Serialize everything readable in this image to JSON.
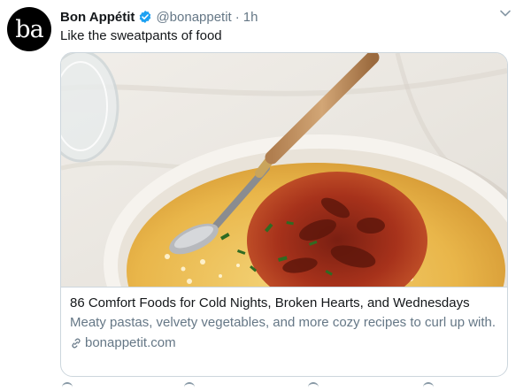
{
  "tweet": {
    "avatar_text": "ba",
    "name": "Bon Appétit",
    "handle": "@bonappetit",
    "separator": "·",
    "time": "1h",
    "text": "Like the sweatpants of food",
    "verified_icon": "verified-badge-icon",
    "menu_icon": "chevron-down-icon"
  },
  "card": {
    "image_icon": "polenta-bowl-photo",
    "title": "86 Comfort Foods for Cold Nights, Broken Hearts, and Wednesdays",
    "description": "Meaty pastas, velvety vegetables, and more cozy recipes to curl up with.",
    "domain": "bonappetit.com",
    "link_icon": "link-icon"
  },
  "colors": {
    "verified_blue": "#1da1f2",
    "secondary_text": "#657786",
    "border": "#ccd6dd"
  }
}
